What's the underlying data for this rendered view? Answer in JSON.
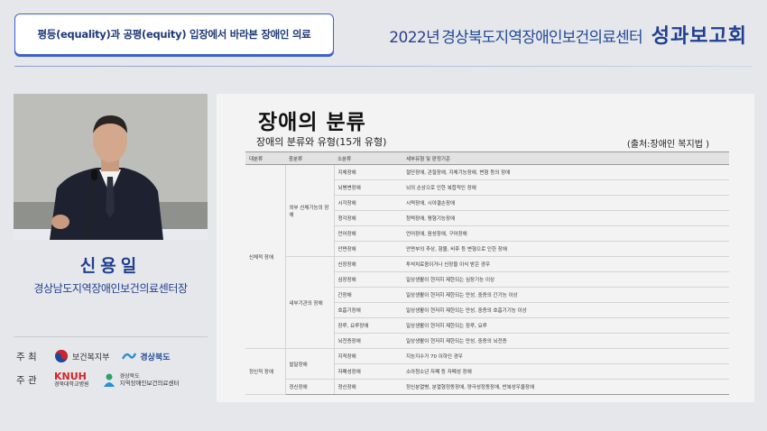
{
  "header": {
    "topic": "평등(equality)과 공평(equity) 입장에서 바라본 장애인 의료",
    "event_year": "2022년",
    "event_center": "경상북도지역장애인보건의료센터",
    "event_report": "성과보고회"
  },
  "speaker": {
    "name": "신용일",
    "title": "경상남도지역장애인보건의료센터장"
  },
  "sponsors": {
    "host_label": "주 최",
    "hosts": [
      "보건복지부",
      "경상북도"
    ],
    "organizer_label": "주 관",
    "organizers": [
      "KNUH",
      "경북대학교병원",
      "경상북도",
      "지역장애인보건의료센터"
    ]
  },
  "slide": {
    "title": "장애의 분류",
    "subtitle": "장애의 분류와 유형(15개 유형)",
    "source": "(출처:장애인 복지법 )",
    "table": {
      "headers": [
        "대분류",
        "중분류",
        "소분류",
        "세부유형 및 판정기준"
      ],
      "groups": {
        "physical": "신체적 장애",
        "external": "외부 신체기능의 장애",
        "internal": "내부기관의 장애",
        "mental": "정신적 장애",
        "developmental": "발달장애",
        "psychiatric": "정신장애"
      },
      "rows": [
        {
          "sub": "지체장애",
          "detail": "절단장애, 관절장애, 지체기능장애, 변형 등의 장애"
        },
        {
          "sub": "뇌병변장애",
          "detail": "뇌의 손상으로 인한 복합적인 장애"
        },
        {
          "sub": "시각장애",
          "detail": "시력장애, 시야결손장애"
        },
        {
          "sub": "청각장애",
          "detail": "청력장애, 평형기능장애"
        },
        {
          "sub": "언어장애",
          "detail": "언어장애, 음성장애, 구어장애"
        },
        {
          "sub": "안면장애",
          "detail": "안면부의 추상, 함몰, 비후 등 변형으로 인한 장애"
        },
        {
          "sub": "신장장애",
          "detail": "투석치료중이거나 신장을 이식 받은 경우"
        },
        {
          "sub": "심장장애",
          "detail": "일상생활이 현저히 제한되는 심장기능 이상"
        },
        {
          "sub": "간장애",
          "detail": "일상생활이 현저히 제한되는 만성, 중증의 간기능 이상"
        },
        {
          "sub": "호흡기장애",
          "detail": "일상생활이 현저히 제한되는 만성, 중증의 호흡기기능 이상"
        },
        {
          "sub": "장루, 요루장애",
          "detail": "일상생활이 현저히 제한되는 장루, 요루"
        },
        {
          "sub": "뇌전증장애",
          "detail": "일상생활이 현저히 제한되는 만성, 중증의 뇌전증"
        },
        {
          "sub": "지적장애",
          "detail": "지능지수가 70 이하인 경우"
        },
        {
          "sub": "자폐성장애",
          "detail": "소아청소년 자폐 등 자폐성 장애"
        },
        {
          "sub": "정신장애",
          "detail": "정신분열병, 분열형정동장애, 양극성정동장애, 반복성우울장애"
        }
      ]
    }
  },
  "colors": {
    "brand_blue": "#1f3f91",
    "accent_blue": "#3c5fd6",
    "knuh_red": "#d2232a"
  }
}
